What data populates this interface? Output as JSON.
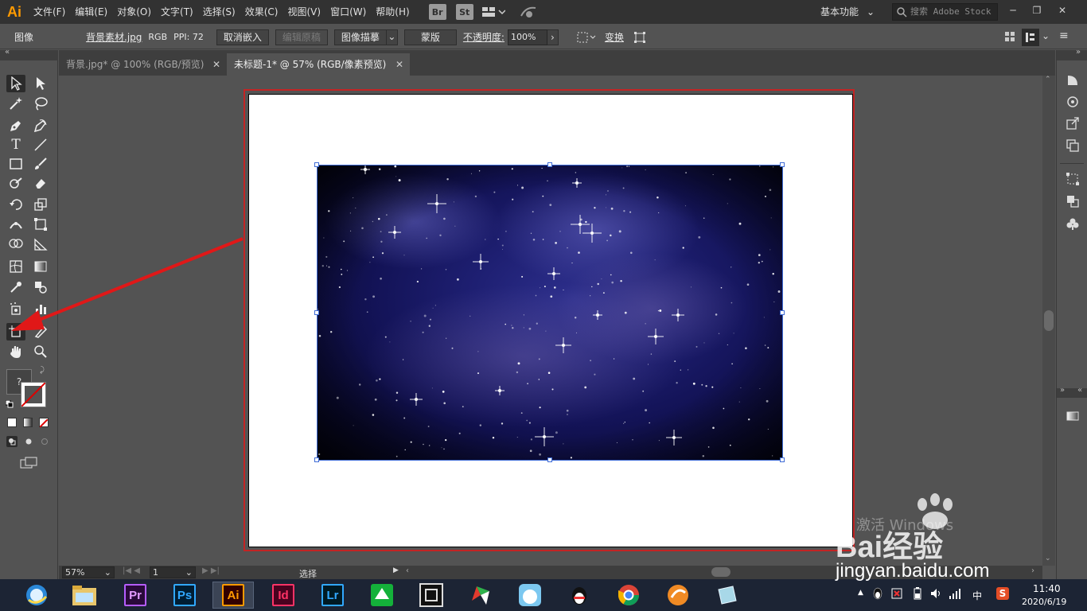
{
  "app": {
    "logo": "Ai"
  },
  "menu": [
    "文件(F)",
    "编辑(E)",
    "对象(O)",
    "文字(T)",
    "选择(S)",
    "效果(C)",
    "视图(V)",
    "窗口(W)",
    "帮助(H)"
  ],
  "menubar_buttons": {
    "bridge": "Br",
    "stock": "St"
  },
  "workspace_label": "基本功能",
  "stock_search_placeholder": "搜索 Adobe Stock",
  "control_bar": {
    "type_label": "图像",
    "file_name": "背景素材.jpg",
    "color_mode": "RGB",
    "ppi": "PPI: 72",
    "unembed_button": "取消嵌入",
    "edit_original_button": "编辑原稿",
    "image_trace_button": "图像描摹",
    "mask_button": "蒙版",
    "opacity_label": "不透明度:",
    "opacity_value": "100%",
    "transform_button": "变换"
  },
  "tabs": [
    {
      "label": "背景.jpg* @ 100% (RGB/预览)",
      "close": "✕",
      "active": false
    },
    {
      "label": "未标题-1* @ 57% (RGB/像素预览)",
      "close": "✕",
      "active": true
    }
  ],
  "toolbar": {
    "help_glyph": "?"
  },
  "status_bar": {
    "zoom": "57%",
    "artboard_number": "1",
    "status_text": "选择"
  },
  "taskbar": {
    "apps": [
      {
        "name": "browser-360",
        "label": ""
      },
      {
        "name": "file-explorer",
        "label": ""
      },
      {
        "name": "premiere",
        "label": "Pr",
        "bg": "#2a0a3a",
        "fg": "#e39bff",
        "border": "#b55dff"
      },
      {
        "name": "photoshop",
        "label": "Ps",
        "bg": "#001d33",
        "fg": "#31a8ff",
        "border": "#31a8ff"
      },
      {
        "name": "illustrator",
        "label": "Ai",
        "bg": "#330000",
        "fg": "#ff9a00",
        "border": "#ff9a00"
      },
      {
        "name": "indesign",
        "label": "Id",
        "bg": "#49021f",
        "fg": "#ff3366",
        "border": "#ff3366"
      },
      {
        "name": "lightroom",
        "label": "Lr",
        "bg": "#001a24",
        "fg": "#31a8ff",
        "border": "#31a8ff"
      }
    ],
    "time": "11:40",
    "date": "2020/6/19",
    "ime": "中"
  },
  "watermark": {
    "activate_text": "激活 Windows",
    "brand": "Bai经验",
    "url": "jingyan.baidu.com"
  },
  "colors": {
    "accent_ai": "#ff9a00",
    "artboard_outline": "#c32424",
    "selection": "#3f6cd6",
    "arrow": "#e01818"
  }
}
